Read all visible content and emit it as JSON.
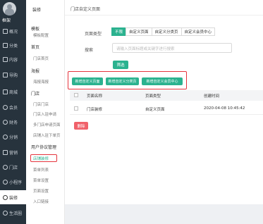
{
  "brand": {
    "name": "框架"
  },
  "main_nav": [
    {
      "label": "概况",
      "icon": "overview-icon"
    },
    {
      "label": "分类",
      "icon": "category-icon"
    },
    {
      "label": "内容",
      "icon": "content-icon"
    },
    {
      "label": "导购",
      "icon": "guide-icon"
    },
    {
      "label": "商城",
      "icon": "shop-icon"
    },
    {
      "label": "会员",
      "icon": "member-icon"
    },
    {
      "label": "财务",
      "icon": "finance-icon"
    },
    {
      "label": "分销",
      "icon": "distribution-icon"
    },
    {
      "label": "营销",
      "icon": "marketing-icon"
    },
    {
      "label": "门店",
      "icon": "store-icon"
    },
    {
      "label": "小程序",
      "icon": "miniapp-icon"
    },
    {
      "label": "装修",
      "icon": "decorate-icon",
      "active": true
    },
    {
      "label": "生活圈",
      "icon": "life-circle-icon"
    }
  ],
  "sub_nav": {
    "header": "装修",
    "groups": [
      {
        "label": "模板",
        "items": [
          "模板配置"
        ]
      },
      {
        "label": "首页",
        "items": [
          "门店首页"
        ]
      },
      {
        "label": "海报",
        "items": [
          "海报海报"
        ]
      },
      {
        "label": "门店",
        "items": [
          "门店门店",
          "门店入驻申请",
          "多门店申请页面",
          "店铺入驻下单页"
        ]
      },
      {
        "label": "用户协议管理",
        "items": [
          "店铺装修",
          "菜单列表",
          "菜单设置",
          "页面设置",
          "入口链接"
        ]
      }
    ],
    "active_item": "店铺装修"
  },
  "topbar": {
    "breadcrumb": "门店自定义页面"
  },
  "filters": {
    "page_type_label": "页面类型",
    "page_type_tabs": [
      "不限",
      "自定义页面",
      "自定义分类页",
      "自定义会员中心"
    ],
    "active_tab": "不限",
    "search_label": "搜索",
    "search_placeholder": "请输入页面标题或关键字进行搜索",
    "filter_button": "筛选"
  },
  "new_buttons": [
    "新增自定义页面",
    "新增自定义分类页",
    "新增自定义会员中心"
  ],
  "table": {
    "columns": [
      "页面名称",
      "页面类型",
      "创建时间"
    ],
    "rows": [
      {
        "name": "门店装修",
        "type": "自定义页面",
        "created": "2020-04-08 10:45:42"
      }
    ]
  },
  "delete_button": "删除",
  "colors": {
    "accent": "#2bb28f",
    "sidebar": "#27333d",
    "danger": "#f0616a",
    "highlight": "#e5343d"
  }
}
